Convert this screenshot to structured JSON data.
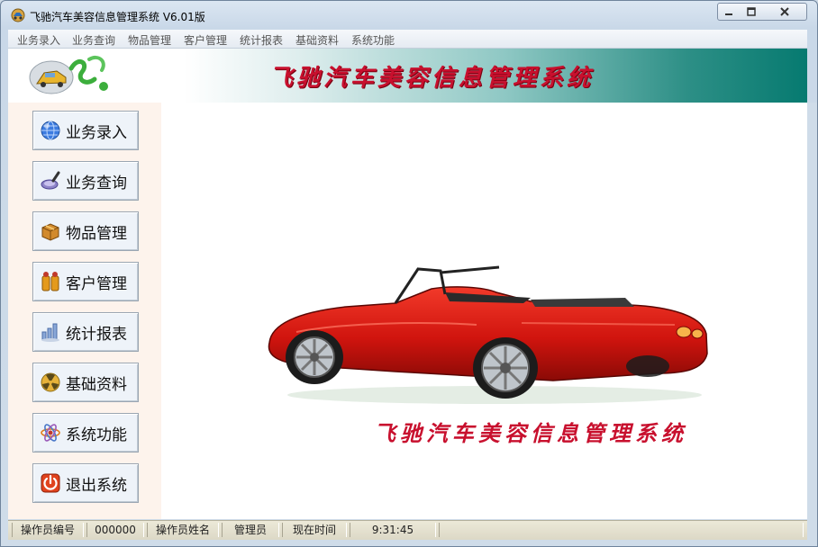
{
  "window": {
    "title": "飞驰汽车美容信息管理系统   V6.01版"
  },
  "menu": {
    "items": [
      {
        "label": "业务录入"
      },
      {
        "label": "业务查询"
      },
      {
        "label": "物品管理"
      },
      {
        "label": "客户管理"
      },
      {
        "label": "统计报表"
      },
      {
        "label": "基础资料"
      },
      {
        "label": "系统功能"
      }
    ]
  },
  "banner": {
    "title": "飞驰汽车美容信息管理系统"
  },
  "sidebar": {
    "items": [
      {
        "label": "业务录入",
        "icon": "globe-icon"
      },
      {
        "label": "业务查询",
        "icon": "magnifier-icon"
      },
      {
        "label": "物品管理",
        "icon": "box-icon"
      },
      {
        "label": "客户管理",
        "icon": "customers-icon"
      },
      {
        "label": "统计报表",
        "icon": "bar-chart-icon"
      },
      {
        "label": "基础资料",
        "icon": "radiation-icon"
      },
      {
        "label": "系统功能",
        "icon": "atom-icon"
      },
      {
        "label": "退出系统",
        "icon": "power-icon"
      }
    ]
  },
  "content": {
    "caption": "飞驰汽车美容信息管理系统"
  },
  "status": {
    "operator_id_label": "操作员编号",
    "operator_id": "000000",
    "operator_name_label": "操作员姓名",
    "operator_name": "管理员",
    "time_label": "现在时间",
    "time": "9:31:45"
  },
  "colors": {
    "banner_text": "#c8102e",
    "banner_teal": "#067a70",
    "sidebar_bg": "#fdf3ec"
  }
}
